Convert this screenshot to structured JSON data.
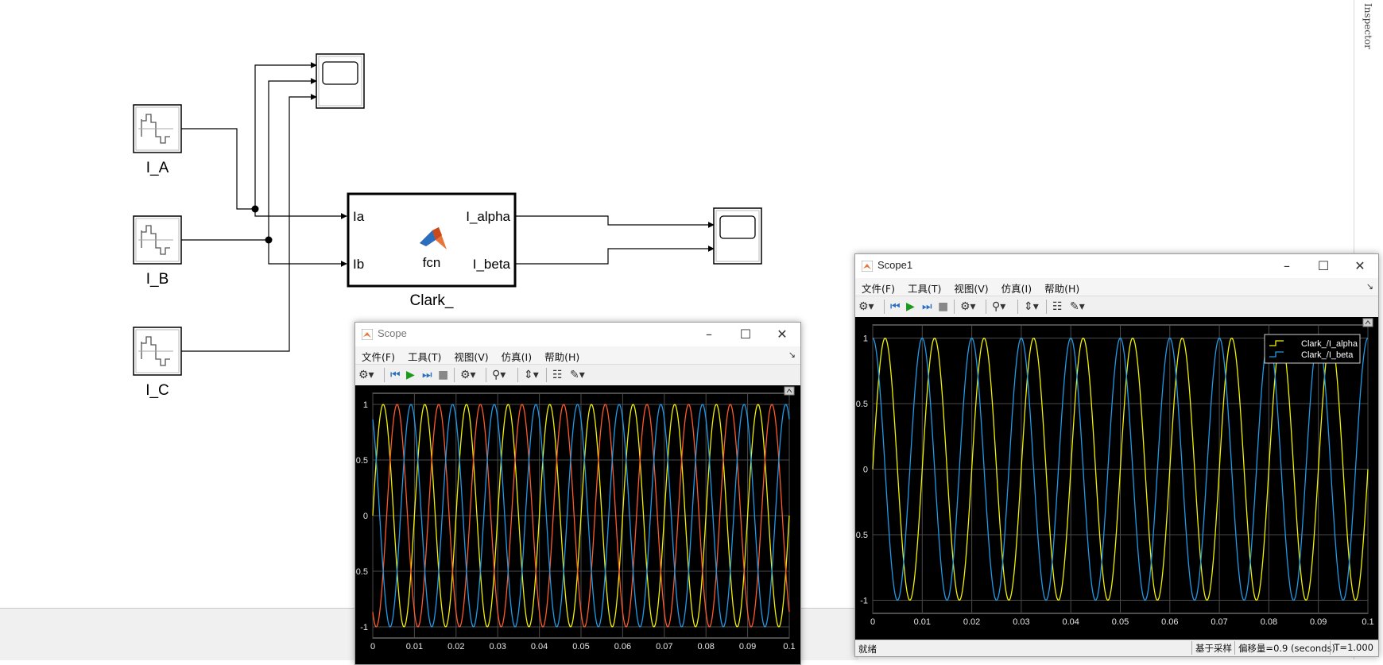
{
  "model": {
    "blocks": {
      "src_a": "I_A",
      "src_b": "I_B",
      "src_c": "I_C",
      "fcn": {
        "name": "Clark_",
        "center_text": "fcn",
        "input_ports": [
          "Ia",
          "Ib"
        ],
        "output_ports": [
          "I_alpha",
          "I_beta"
        ]
      }
    }
  },
  "right_sidebar": {
    "label": "Inspector"
  },
  "scope": {
    "title": "Scope",
    "menu": [
      "文件(F)",
      "工具(T)",
      "视图(V)",
      "仿真(I)",
      "帮助(H)"
    ],
    "chart_data": {
      "type": "line",
      "x_range": [
        0,
        0.1
      ],
      "ylim": [
        -1.1,
        1.1
      ],
      "xticks": [
        0,
        0.01,
        0.02,
        0.03,
        0.04,
        0.05,
        0.06,
        0.07,
        0.08,
        0.09,
        0.1
      ],
      "xtick_labels": [
        "0",
        "0.01",
        "0.02",
        "0.03",
        "0.04",
        "0.05",
        "0.06",
        "0.07",
        "0.08",
        "0.09",
        "0.1"
      ],
      "yticks": [
        -1,
        -0.5,
        0,
        0.5,
        1
      ],
      "ytick_labels": [
        "-1",
        "-0.5",
        "0",
        "0.5",
        "1"
      ],
      "grid": true,
      "series": [
        {
          "frequency_hz": 100,
          "phase_deg": 0,
          "amplitude": 1,
          "color": "#f2f200"
        },
        {
          "frequency_hz": 100,
          "phase_deg": -120,
          "amplitude": 1,
          "color": "#ff5a2a"
        },
        {
          "frequency_hz": 100,
          "phase_deg": 120,
          "amplitude": 1,
          "color": "#1f9be8"
        }
      ]
    }
  },
  "scope1": {
    "title": "Scope1",
    "menu": [
      "文件(F)",
      "工具(T)",
      "视图(V)",
      "仿真(I)",
      "帮助(H)"
    ],
    "status": {
      "left": "就绪",
      "mode": "基于采样",
      "offset": "偏移量=0.9 (seconds)",
      "time": "T=1.000"
    },
    "chart_data": {
      "type": "line",
      "x_range": [
        0,
        0.1
      ],
      "ylim": [
        -1.1,
        1.1
      ],
      "xticks": [
        0,
        0.01,
        0.02,
        0.03,
        0.04,
        0.05,
        0.06,
        0.07,
        0.08,
        0.09,
        0.1
      ],
      "xtick_labels": [
        "0",
        "0.01",
        "0.02",
        "0.03",
        "0.04",
        "0.05",
        "0.06",
        "0.07",
        "0.08",
        "0.09",
        "0.1"
      ],
      "yticks": [
        -1,
        -0.5,
        0,
        0.5,
        1
      ],
      "ytick_labels": [
        "-1",
        "-0.5",
        "0",
        "0.5",
        "1"
      ],
      "grid": true,
      "legend_position": "top-right",
      "series": [
        {
          "name": "Clark_/I_alpha",
          "frequency_hz": 100,
          "phase_deg": 0,
          "amplitude": 1,
          "color": "#f2f200"
        },
        {
          "name": "Clark_/I_beta",
          "frequency_hz": 100,
          "phase_deg": 90,
          "amplitude": 1,
          "color": "#1f9be8"
        }
      ]
    }
  }
}
